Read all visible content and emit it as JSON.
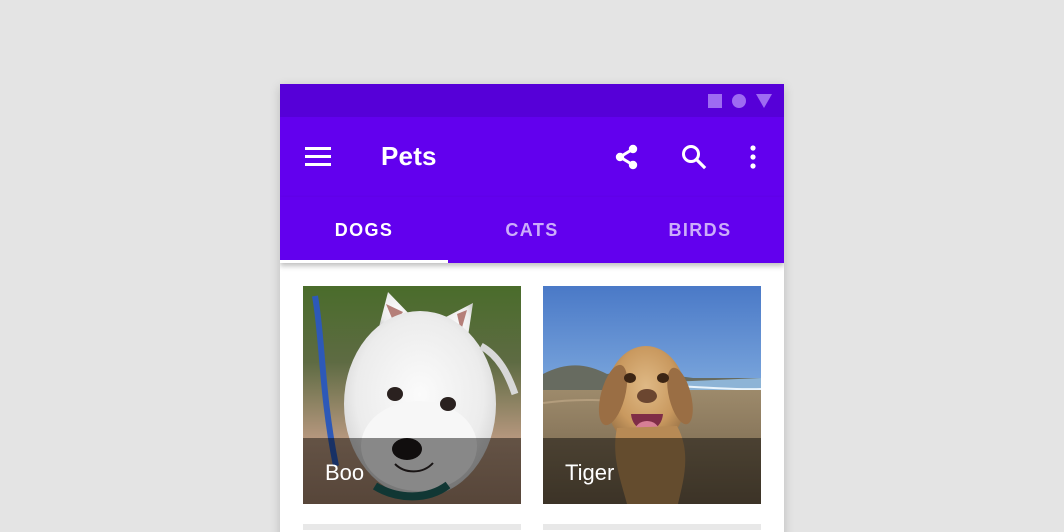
{
  "app": {
    "title": "Pets",
    "primary_color": "#6200ee",
    "status_bar_color": "#5600d8"
  },
  "status_bar": {
    "icons": [
      "square-icon",
      "circle-icon",
      "triangle-icon"
    ]
  },
  "app_bar": {
    "actions": [
      "menu-icon",
      "share-icon",
      "search-icon",
      "more-vert-icon"
    ]
  },
  "tabs": [
    {
      "label": "DOGS",
      "active": true
    },
    {
      "label": "CATS",
      "active": false
    },
    {
      "label": "BIRDS",
      "active": false
    }
  ],
  "grid": {
    "items": [
      {
        "label": "Boo",
        "image": "white-terrier-photo"
      },
      {
        "label": "Tiger",
        "image": "yellow-lab-beach-photo"
      }
    ]
  }
}
